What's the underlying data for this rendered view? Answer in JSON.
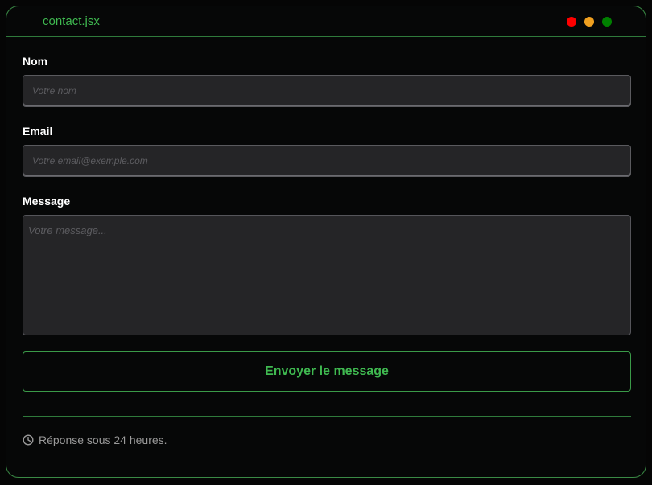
{
  "window": {
    "title": "contact.jsx",
    "dots": [
      {
        "name": "close-dot",
        "color": "#ff0000"
      },
      {
        "name": "minimize-dot",
        "color": "#f0a020"
      },
      {
        "name": "maximize-dot",
        "color": "#008000"
      }
    ]
  },
  "form": {
    "name_label": "Nom",
    "name_placeholder": "Votre nom",
    "email_label": "Email",
    "email_placeholder": "Votre.email@exemple.com",
    "message_label": "Message",
    "message_placeholder": "Votre message...",
    "submit_label": "Envoyer le message"
  },
  "footer": {
    "icon": "clock-icon",
    "text": "Réponse sous 24 heures."
  },
  "colors": {
    "accent": "#3fb950",
    "border": "#3a8a45",
    "field_bg": "#252527",
    "background": "#060707"
  }
}
